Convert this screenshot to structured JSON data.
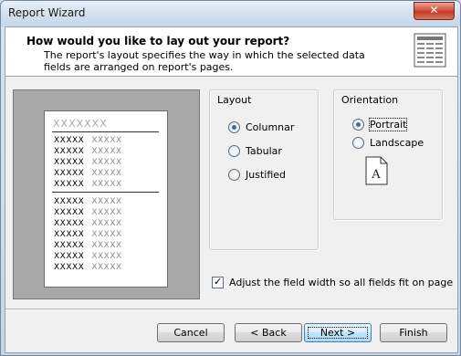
{
  "window": {
    "title": "Report Wizard",
    "close_glyph": "✕"
  },
  "header": {
    "heading": "How would you like to lay out your report?",
    "description": "The report's layout specifies the way in which the selected data fields are arranged on report's pages.",
    "icon": "report-layout-icon"
  },
  "preview": {
    "title": "XXXXXXX",
    "rows": [
      {
        "key": "XXXXX",
        "value": "XXXXX"
      },
      {
        "key": "XXXXX",
        "value": "XXXXX"
      },
      {
        "key": "XXXXX",
        "value": "XXXXX"
      },
      {
        "key": "XXXXX",
        "value": "XXXXX"
      },
      {
        "key": "XXXXX",
        "value": "XXXXX"
      },
      {
        "key": "XXXXX",
        "value": "XXXXX"
      },
      {
        "key": "XXXXX",
        "value": "XXXXX"
      },
      {
        "key": "XXXXX",
        "value": "XXXXX"
      },
      {
        "key": "XXXXX",
        "value": "XXXXX"
      },
      {
        "key": "XXXXX",
        "value": "XXXXX"
      },
      {
        "key": "XXXXX",
        "value": "XXXXX"
      },
      {
        "key": "XXXXX",
        "value": "XXXXX"
      }
    ]
  },
  "layout": {
    "label": "Layout",
    "options": [
      {
        "label": "Columnar",
        "selected": true
      },
      {
        "label": "Tabular",
        "selected": false
      },
      {
        "label": "Justified",
        "selected": false
      }
    ]
  },
  "orientation": {
    "label": "Orientation",
    "options": [
      {
        "label": "Portrait",
        "selected": true
      },
      {
        "label": "Landscape",
        "selected": false
      }
    ],
    "preview_letter": "A"
  },
  "adjust": {
    "label": "Adjust the field width so all fields fit on page",
    "checked": true
  },
  "buttons": {
    "cancel": "Cancel",
    "back": "< Back",
    "next": "Next >",
    "finish": "Finish"
  }
}
